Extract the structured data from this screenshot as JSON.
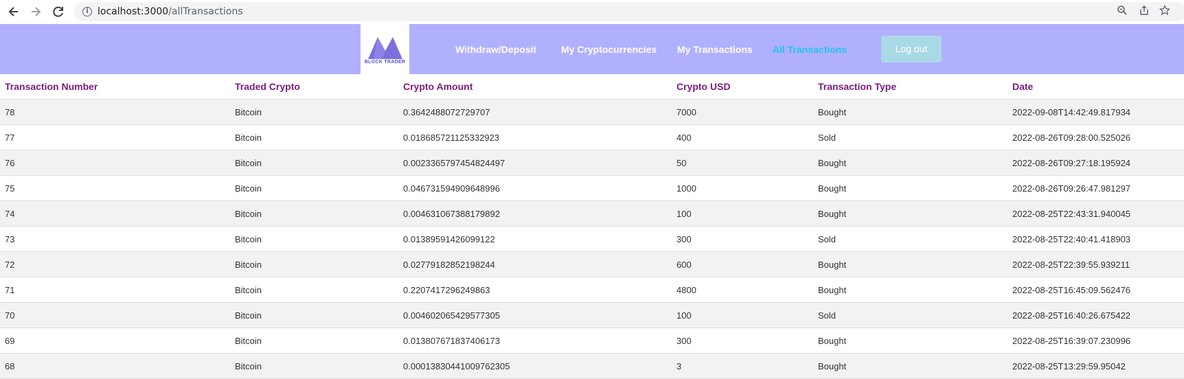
{
  "browser": {
    "url_host": "localhost:3000",
    "url_path": "/allTransactions"
  },
  "header": {
    "logo_text": "BLOCK   TRADER",
    "nav": [
      {
        "label": "Withdraw/Deposit"
      },
      {
        "label": "My Cryptocurrencies"
      },
      {
        "label": "My Transactions"
      },
      {
        "label": "All Transactions",
        "active": true
      }
    ],
    "logout_label": "Log out",
    "colors": {
      "header_bg": "#b1b0fe",
      "active_link": "#1ec6f2",
      "logout_bg": "#aad9e6",
      "column_header": "#7a1b7f"
    }
  },
  "table": {
    "columns": [
      "Transaction Number",
      "Traded Crypto",
      "Crypto Amount",
      "Crypto USD",
      "Transaction Type",
      "Date"
    ],
    "rows": [
      [
        "78",
        "Bitcoin",
        "0.3642488072729707",
        "7000",
        "Bought",
        "2022-09-08T14:42:49.817934"
      ],
      [
        "77",
        "Bitcoin",
        "0.018685721125332923",
        "400",
        "Sold",
        "2022-08-26T09:28:00.525026"
      ],
      [
        "76",
        "Bitcoin",
        "0.0023365797454824497",
        "50",
        "Bought",
        "2022-08-26T09:27:18.195924"
      ],
      [
        "75",
        "Bitcoin",
        "0.046731594909648996",
        "1000",
        "Bought",
        "2022-08-26T09:26:47.981297"
      ],
      [
        "74",
        "Bitcoin",
        "0.004631067388179892",
        "100",
        "Bought",
        "2022-08-25T22:43:31.940045"
      ],
      [
        "73",
        "Bitcoin",
        "0.01389591426099122",
        "300",
        "Sold",
        "2022-08-25T22:40:41.418903"
      ],
      [
        "72",
        "Bitcoin",
        "0.02779182852198244",
        "600",
        "Bought",
        "2022-08-25T22:39:55.939211"
      ],
      [
        "71",
        "Bitcoin",
        "0.2207417296249863",
        "4800",
        "Bought",
        "2022-08-25T16:45:09.562476"
      ],
      [
        "70",
        "Bitcoin",
        "0.004602065429577305",
        "100",
        "Sold",
        "2022-08-25T16:40:26.675422"
      ],
      [
        "69",
        "Bitcoin",
        "0.013807671837406173",
        "300",
        "Bought",
        "2022-08-25T16:39:07.230996"
      ],
      [
        "68",
        "Bitcoin",
        "0.00013830441009762305",
        "3",
        "Bought",
        "2022-08-25T13:29:59.95042"
      ]
    ]
  }
}
